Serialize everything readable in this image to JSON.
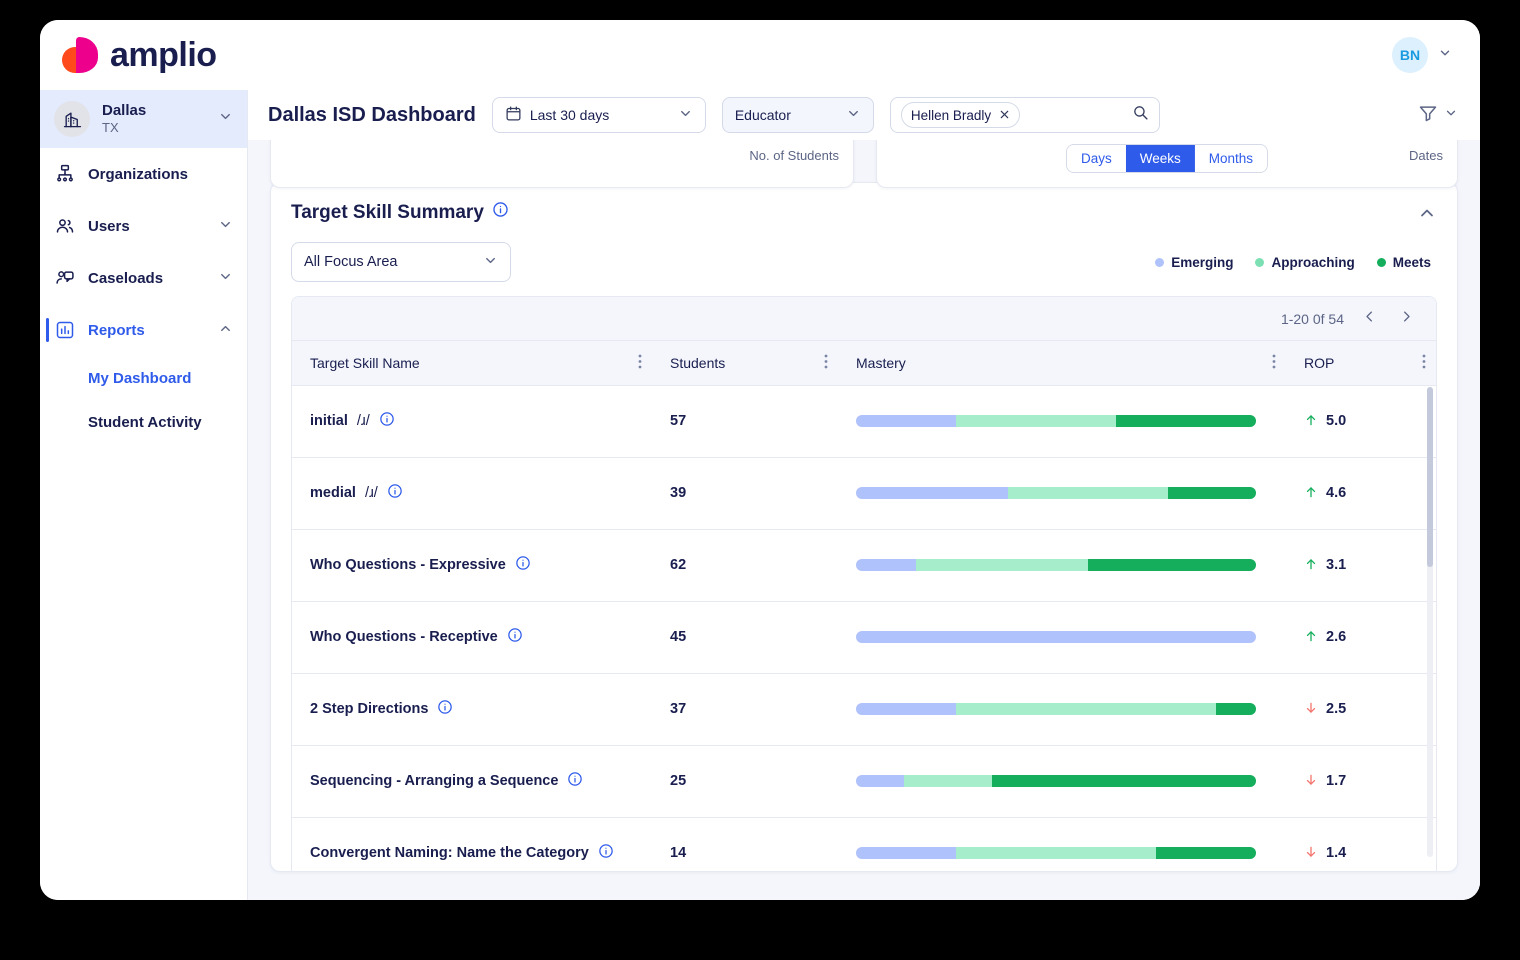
{
  "brand": {
    "name": "amplio",
    "accent_pink": "#EC008C",
    "accent_orange": "#FF4A1C",
    "ink": "#191E4F",
    "primary": "#2F5BEA"
  },
  "account": {
    "initials": "BN"
  },
  "sidebar": {
    "org": {
      "name": "Dallas",
      "state": "TX"
    },
    "items": [
      {
        "label": "Organizations",
        "icon": "organizations-icon",
        "expandable": false,
        "active": false
      },
      {
        "label": "Users",
        "icon": "users-icon",
        "expandable": true,
        "active": false
      },
      {
        "label": "Caseloads",
        "icon": "caseloads-icon",
        "expandable": true,
        "active": false
      },
      {
        "label": "Reports",
        "icon": "reports-icon",
        "expandable": true,
        "active": true
      }
    ],
    "sub_items": [
      {
        "label": "My Dashboard",
        "active": true
      },
      {
        "label": "Student Activity",
        "active": false
      }
    ]
  },
  "toolbar": {
    "page_title": "Dallas ISD Dashboard",
    "date_range": "Last 30 days",
    "role_filter": "Educator",
    "search_chip": "Hellen Bradly",
    "search_placeholder": "",
    "filter_icon": "funnel-icon"
  },
  "cards": {
    "left": {
      "label": "No. of Students"
    },
    "right": {
      "label": "Dates",
      "segments": [
        {
          "label": "Days",
          "active": false
        },
        {
          "label": "Weeks",
          "active": true
        },
        {
          "label": "Months",
          "active": false
        }
      ]
    }
  },
  "panel": {
    "title": "Target Skill Summary",
    "focus_area": "All Focus Area",
    "legend": [
      {
        "label": "Emerging",
        "color": "#B0C2FB"
      },
      {
        "label": "Approaching",
        "color": "#A5EDCB"
      },
      {
        "label": "Meets",
        "color": "#14AE5C"
      }
    ],
    "pagination": {
      "range": "1-20 0f 54",
      "prev": "‹",
      "next": "›"
    },
    "columns": [
      {
        "label": "Target Skill Name"
      },
      {
        "label": "Students"
      },
      {
        "label": "Mastery"
      },
      {
        "label": "ROP"
      }
    ],
    "rows": [
      {
        "skill": "initial",
        "phonetic": "/ɹ/",
        "students": "57",
        "mastery": {
          "emerging": 25,
          "approaching": 40,
          "meets": 35
        },
        "rop": {
          "value": "5.0",
          "dir": "up"
        }
      },
      {
        "skill": "medial",
        "phonetic": "/ɹ/",
        "students": "39",
        "mastery": {
          "emerging": 38,
          "approaching": 40,
          "meets": 22
        },
        "rop": {
          "value": "4.6",
          "dir": "up"
        }
      },
      {
        "skill": "Who Questions - Expressive",
        "phonetic": "",
        "students": "62",
        "mastery": {
          "emerging": 15,
          "approaching": 43,
          "meets": 42
        },
        "rop": {
          "value": "3.1",
          "dir": "up"
        }
      },
      {
        "skill": "Who Questions - Receptive",
        "phonetic": "",
        "students": "45",
        "mastery": {
          "emerging": 100,
          "approaching": 0,
          "meets": 0
        },
        "rop": {
          "value": "2.6",
          "dir": "up"
        }
      },
      {
        "skill": "2 Step Directions",
        "phonetic": "",
        "students": "37",
        "mastery": {
          "emerging": 25,
          "approaching": 65,
          "meets": 10
        },
        "rop": {
          "value": "2.5",
          "dir": "down"
        }
      },
      {
        "skill": "Sequencing - Arranging a Sequence",
        "phonetic": "",
        "students": "25",
        "mastery": {
          "emerging": 12,
          "approaching": 22,
          "meets": 66
        },
        "rop": {
          "value": "1.7",
          "dir": "down"
        }
      },
      {
        "skill": "Convergent Naming: Name the Category",
        "phonetic": "",
        "students": "14",
        "mastery": {
          "emerging": 25,
          "approaching": 50,
          "meets": 25
        },
        "rop": {
          "value": "1.4",
          "dir": "down"
        }
      }
    ]
  }
}
